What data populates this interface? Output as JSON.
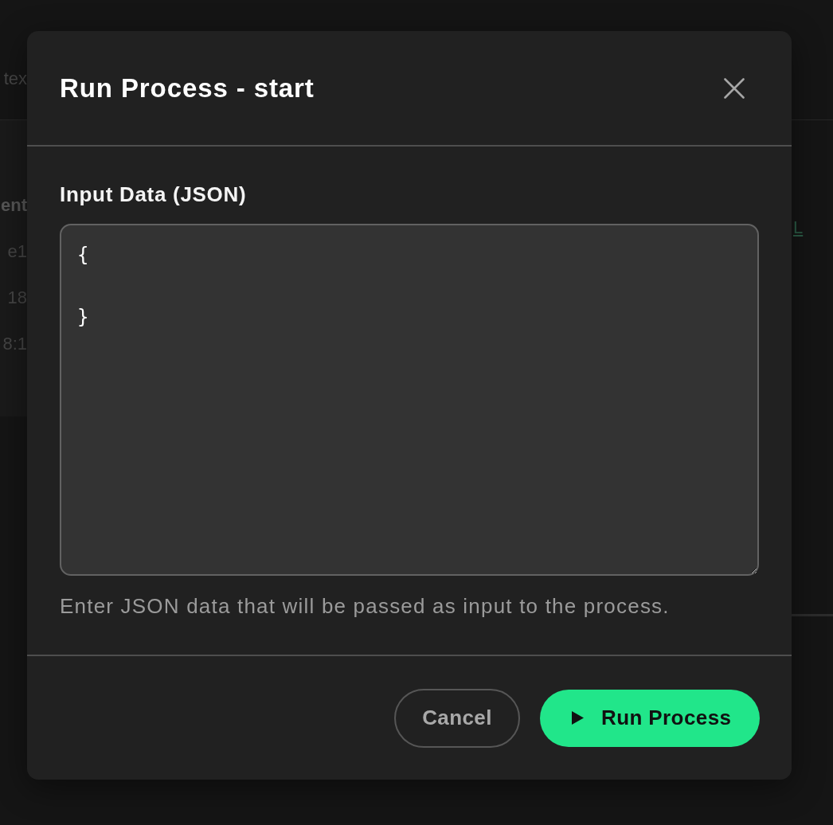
{
  "background_page": {
    "header_text": "tex",
    "details": [
      {
        "kind": "heading",
        "text": "ent"
      },
      {
        "kind": "value",
        "text": "e1"
      },
      {
        "kind": "value",
        "text": "18"
      },
      {
        "kind": "value",
        "text": "8:1"
      }
    ],
    "link": "L"
  },
  "dialog": {
    "title": "Run Process - start",
    "field": {
      "label": "Input Data (JSON)",
      "value": "{\n\n}",
      "help": "Enter JSON data that will be passed as input to the process."
    },
    "buttons": [
      {
        "kind": "secondary",
        "label": "Cancel"
      },
      {
        "kind": "primary",
        "label": "Run Process"
      }
    ]
  }
}
